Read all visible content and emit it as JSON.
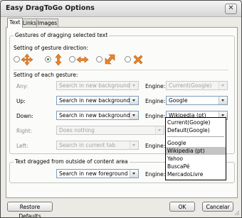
{
  "window": {
    "title": "Easy DragToGo Options",
    "close_glyph": "✕"
  },
  "tabs": [
    {
      "label": "Text",
      "active": true
    },
    {
      "label": "Links",
      "active": false
    },
    {
      "label": "Images",
      "active": false
    }
  ],
  "gestures_group": {
    "title": "Gestures of dragging selected text",
    "direction_label": "Setting of gesture direction:",
    "direction_options": [
      {
        "icon": "four-way-arrows-icon",
        "selected": false
      },
      {
        "icon": "vertical-arrows-icon",
        "selected": true
      },
      {
        "icon": "horizontal-arrows-icon",
        "selected": false
      },
      {
        "icon": "diagonal-arrow-icon",
        "selected": false
      },
      {
        "icon": "cross-icon",
        "selected": false
      }
    ],
    "each_label": "Setting of each gesture:",
    "engine_label": "Engine:",
    "rows": [
      {
        "label": "Any:",
        "action": "Search in new background tab",
        "engine": "Current(Google)",
        "enabled": false,
        "has_engine": true
      },
      {
        "label": "Up:",
        "action": "Search in new background tab",
        "engine": "Google",
        "enabled": true,
        "has_engine": true
      },
      {
        "label": "Down:",
        "action": "Search in new background tab",
        "engine": "Wikipedia (pt)",
        "enabled": true,
        "has_engine": true
      },
      {
        "label": "Right:",
        "action": "Does nothing",
        "engine": "",
        "enabled": false,
        "has_engine": false
      },
      {
        "label": "Left:",
        "action": "Search in current tab",
        "engine": "",
        "enabled": false,
        "has_engine": true
      }
    ]
  },
  "outside_group": {
    "title": "Text dragged from outside of content area",
    "action": "Search in new foreground tab",
    "engine_label": "Engine:"
  },
  "engine_dropdown": {
    "options": [
      "Current(Google)",
      "Default(Google)",
      "Google",
      "Wikipedia (pt)",
      "Yahoo",
      "BuscaPé",
      "MercadoLivre"
    ],
    "highlighted": "Wikipedia (pt)"
  },
  "footer": {
    "restore": "Restore Defaults",
    "ok": "OK",
    "cancel": "Cancelar"
  },
  "colors": {
    "accent_green": "#3c7a2a",
    "gesture_orange": "#e8862a",
    "highlight": "#c4c4c4"
  }
}
